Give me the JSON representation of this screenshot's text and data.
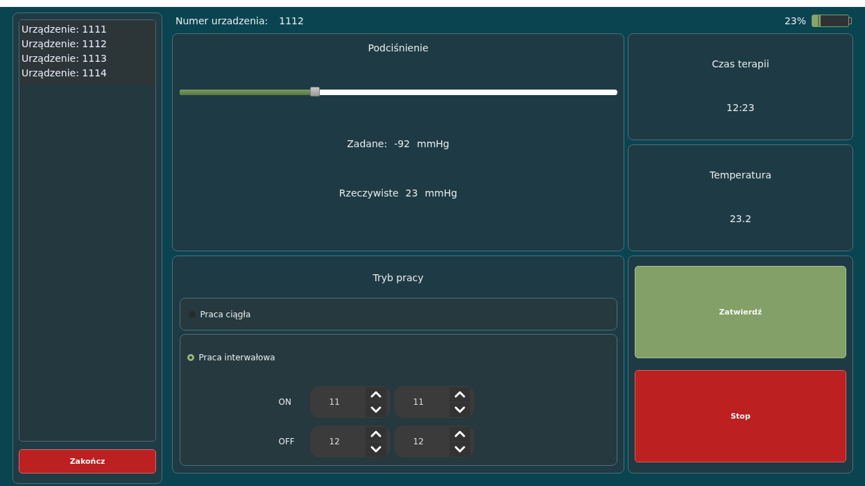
{
  "devices": [
    {
      "label": "Urządzenie: 1111"
    },
    {
      "label": "Urządzenie: 1112"
    },
    {
      "label": "Urządzenie: 1113"
    },
    {
      "label": "Urządzenie: 1114"
    }
  ],
  "exit_button": "Zakończ",
  "device_number": {
    "label": "Numer urzadzenia:",
    "value": "1112"
  },
  "battery": {
    "reading": "23%",
    "level": 0.23
  },
  "pressure": {
    "title": "Podciśnienie",
    "level": 0.31,
    "set": {
      "label": "Zadane:",
      "value": "-92",
      "unit": "mmHg"
    },
    "actual": {
      "label": "Rzeczywiste",
      "value": "23",
      "unit": "mmHg"
    }
  },
  "therapy_time": {
    "title": "Czas terapii",
    "value": "12:23"
  },
  "temperature": {
    "title": "Temperatura",
    "value": "23.2"
  },
  "mode": {
    "title": "Tryb pracy",
    "options": [
      {
        "label": "Praca ciągła",
        "selected": false
      },
      {
        "label": "Praca interwałowa",
        "selected": true
      }
    ],
    "intervals": [
      {
        "label": "ON",
        "values": [
          "11",
          "11"
        ]
      },
      {
        "label": "OFF",
        "values": [
          "12",
          "12"
        ]
      }
    ]
  },
  "buttons": [
    {
      "label": "Zatwierdź",
      "kind": "confirm"
    },
    {
      "label": "Stop",
      "kind": "stop"
    }
  ]
}
